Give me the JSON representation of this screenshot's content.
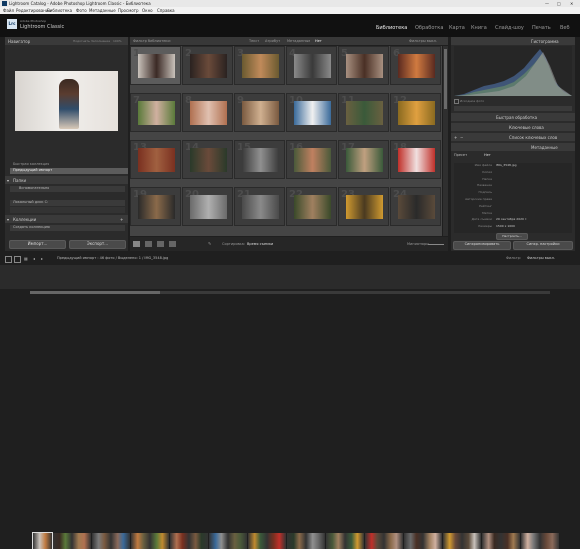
{
  "window": {
    "title": "Lightroom Catalog - Adobe Photoshop Lightroom Classic - Библиотека"
  },
  "menu": [
    "Файл",
    "Редактирование",
    "Библиотека",
    "Фото",
    "Метаданные",
    "Просмотр",
    "Окно",
    "Справка"
  ],
  "identity": {
    "brand_small": "Adobe Photoshop",
    "brand_name": "Lightroom Classic",
    "logo": "Lrc"
  },
  "modules": [
    "Библиотека",
    "Обработка",
    "Карта",
    "Книга",
    "Слайд-шоу",
    "Печать",
    "Веб"
  ],
  "left_panel": {
    "navigator": {
      "title": "Навигатор",
      "zoom": [
        "Подогнать",
        "Заполнение",
        "100%"
      ]
    },
    "catalog_items": [
      "Быстрая коллекция",
      "Предыдущий импорт"
    ],
    "folders_title": "Папки",
    "folder_item": "Вспомогательно",
    "volume": "Локальный диск C:",
    "collections_title": "Коллекции",
    "collections_item": "Создать коллекцию",
    "import_btn": "Импорт...",
    "export_btn": "Экспорт..."
  },
  "filter_bar": {
    "title": "Фильтр библиотеки:",
    "tabs": [
      "Текст",
      "Атрибут",
      "Метаданные",
      "Нет"
    ],
    "preset": "Фильтры выкл."
  },
  "grid": {
    "numbers": [
      "1",
      "2",
      "3",
      "4",
      "5",
      "6",
      "7",
      "8",
      "9",
      "10",
      "11",
      "12",
      "13",
      "14",
      "15",
      "16",
      "17",
      "18",
      "19",
      "20",
      "21",
      "22",
      "23",
      "24"
    ]
  },
  "toolbar": {
    "sort_label": "Сортировка:",
    "sort_value": "Время съемки",
    "thumbnails_label": "Миниатюры"
  },
  "right_panel": {
    "histogram_title": "Гистограмма",
    "original_photo": "Исходное фото",
    "quick_develop": "Быстрая обработка",
    "keywording": "Ключевые слова",
    "keyword_list": "Список ключевых слов",
    "metadata_title": "Метаданные",
    "preset_label": "Пресет",
    "preset_value": "Нет",
    "meta_rows": [
      {
        "label": "Имя файла",
        "value": "IMG_3548.jpg"
      },
      {
        "label": "Копия",
        "value": ""
      },
      {
        "label": "Папка",
        "value": ""
      },
      {
        "label": "Название",
        "value": ""
      },
      {
        "label": "Подпись",
        "value": ""
      },
      {
        "label": "Авторские права",
        "value": ""
      },
      {
        "label": "Рейтинг",
        "value": ""
      },
      {
        "label": "Метка",
        "value": ""
      },
      {
        "label": "Дата съемки",
        "value": "29 сентября 2020 г."
      },
      {
        "label": "Размеры",
        "value": "1500 x 1000"
      }
    ],
    "customize_btn": "Настроить...",
    "sync_btn": "Синхронизировать",
    "sync_settings_btn": "Синхр. настройки"
  },
  "filmstrip": {
    "source": "Предыдущий импорт : 46 фото / Выделено: 1 / IMG_3548.jpg",
    "filter_label": "Фильтр:",
    "filter_value": "Фильтры выкл."
  },
  "colors": {
    "accent": "#d0d0d0",
    "panel": "#2b2b2b",
    "grid_bg": "#454545"
  }
}
